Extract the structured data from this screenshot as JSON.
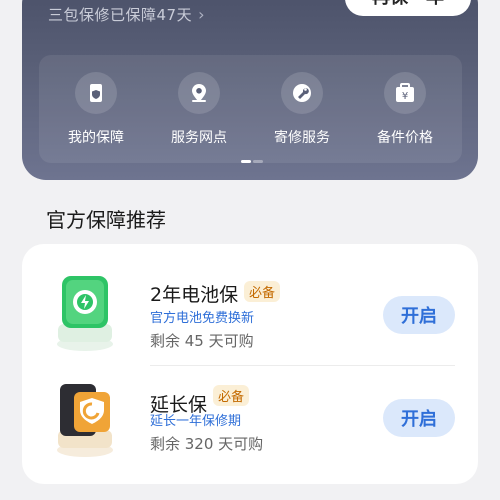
{
  "header": {
    "guarantee_text": "三包保修已保障47天",
    "chevron": "›",
    "renew_label": "再保一年"
  },
  "services": [
    {
      "label": "我的保障",
      "icon": "phone-shield-icon"
    },
    {
      "label": "服务网点",
      "icon": "location-pin-icon"
    },
    {
      "label": "寄修服务",
      "icon": "repair-wrench-icon"
    },
    {
      "label": "备件价格",
      "icon": "toolbox-price-icon"
    }
  ],
  "section": {
    "title": "官方保障推荐"
  },
  "products": [
    {
      "name": "2年电池保",
      "tag": "必备",
      "subtitle": "官方电池免费换新",
      "remaining": "剩余 45 天可购",
      "button": "开启",
      "icon": "battery-shield-icon"
    },
    {
      "name": "延长保",
      "tag": "必备",
      "subtitle": "延长一年保修期",
      "remaining": "剩余 320 天可购",
      "button": "开启",
      "icon": "extended-warranty-icon"
    }
  ],
  "colors": {
    "accent": "#2f6fd8",
    "tag_text": "#c46a00",
    "tag_bg": "#fbefd6",
    "hero_bg": "#555b73"
  }
}
